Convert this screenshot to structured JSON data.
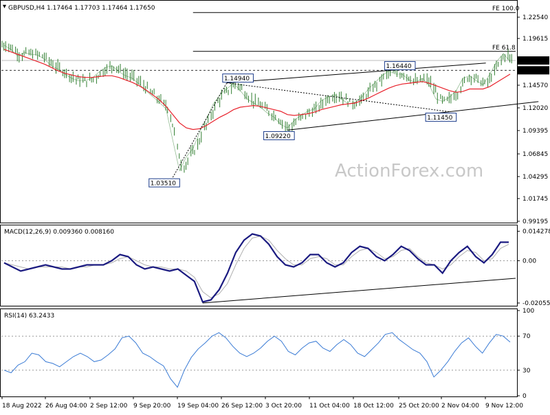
{
  "header": {
    "symbol": "GBPUSD,H4",
    "ohlc": "1.17464 1.17703 1.17464 1.17650"
  },
  "watermark": "ActionForex.com",
  "colors": {
    "ema_red": "#e8202a",
    "macd_blue": "#1a1a80",
    "signal_gray": "#b0b0b0",
    "rsi_blue": "#3a7bd5",
    "candle": "#2e7d2e",
    "lines": "#000000",
    "dashed": "#333333"
  },
  "chart_data": [
    {
      "type": "line",
      "panel": "price",
      "series": [
        {
          "values": [
            1.195,
            1.19,
            1.182,
            1.186,
            1.184,
            1.183,
            1.178,
            1.17,
            1.166,
            1.16,
            1.155,
            1.152,
            1.152,
            1.155,
            1.162,
            1.168,
            1.17,
            1.163,
            1.158,
            1.155,
            1.148,
            1.14,
            1.133,
            1.126,
            1.118,
            1.08,
            1.043,
            1.06,
            1.07,
            1.09,
            1.106,
            1.124,
            1.135,
            1.142,
            1.149,
            1.14,
            1.13,
            1.125,
            1.12,
            1.113,
            1.108,
            1.099,
            1.095,
            1.104,
            1.11,
            1.115,
            1.118,
            1.128,
            1.132,
            1.135,
            1.13,
            1.124,
            1.126,
            1.132,
            1.142,
            1.15,
            1.158,
            1.164,
            1.16,
            1.16,
            1.153,
            1.15,
            1.155,
            1.147,
            1.13,
            1.127,
            1.132,
            1.14,
            1.155,
            1.158,
            1.152,
            1.147,
            1.16,
            1.175,
            1.185,
            1.175
          ]
        },
        {
          "name": "EMA",
          "values": [
            1.19,
            1.187,
            1.184,
            1.181,
            1.178,
            1.175,
            1.172,
            1.168,
            1.164,
            1.161,
            1.159,
            1.157,
            1.156,
            1.156,
            1.157,
            1.158,
            1.158,
            1.156,
            1.153,
            1.15,
            1.146,
            1.141,
            1.135,
            1.129,
            1.121,
            1.111,
            1.101,
            1.095,
            1.093,
            1.094,
            1.098,
            1.103,
            1.108,
            1.112,
            1.117,
            1.12,
            1.121,
            1.122,
            1.121,
            1.119,
            1.117,
            1.115,
            1.111,
            1.11,
            1.111,
            1.112,
            1.114,
            1.117,
            1.119,
            1.121,
            1.123,
            1.124,
            1.125,
            1.128,
            1.131,
            1.135,
            1.139,
            1.143,
            1.146,
            1.148,
            1.149,
            1.15,
            1.151,
            1.149,
            1.146,
            1.143,
            1.14,
            1.138,
            1.139,
            1.142,
            1.142,
            1.142,
            1.145,
            1.15,
            1.155,
            1.16
          ]
        }
      ],
      "price_ticks": [
        "1.22540",
        "1.19615",
        "1.14570",
        "1.12020",
        "1.09395",
        "1.06845",
        "1.04295",
        "1.01745",
        "0.99195"
      ],
      "price_tags": [
        "1.17650",
        "1.16460"
      ],
      "annotations": [
        {
          "label": "1.03510",
          "x": 25,
          "y": 1.0351
        },
        {
          "label": "1.14940",
          "x": 33,
          "y": 1.1494
        },
        {
          "label": "1.09220",
          "x": 42,
          "y": 1.0922
        },
        {
          "label": "1.16440",
          "x": 57,
          "y": 1.1644
        },
        {
          "label": "1.11450",
          "x": 66,
          "y": 1.1145
        },
        {
          "label": "FE 100.0",
          "y": 1.2345
        },
        {
          "label": "FE 61.8",
          "y": 1.1875
        }
      ]
    },
    {
      "type": "line",
      "panel": "macd",
      "title": "MACD(12,26,9) 0.009360 0.008160",
      "ticks": [
        "0.014278",
        "0.00",
        "-0.020556"
      ],
      "series": [
        {
          "name": "MACD",
          "values": [
            -0.001,
            -0.003,
            -0.005,
            -0.004,
            -0.003,
            -0.002,
            -0.003,
            -0.004,
            -0.004,
            -0.003,
            -0.002,
            -0.002,
            -0.002,
            0.0,
            0.003,
            0.002,
            -0.002,
            -0.004,
            -0.003,
            -0.004,
            -0.005,
            -0.004,
            -0.007,
            -0.01,
            -0.02,
            -0.019,
            -0.014,
            -0.006,
            0.004,
            0.01,
            0.013,
            0.012,
            0.008,
            0.002,
            -0.002,
            -0.003,
            -0.001,
            0.003,
            0.003,
            -0.001,
            -0.003,
            -0.001,
            0.004,
            0.007,
            0.006,
            0.002,
            0.0,
            0.003,
            0.007,
            0.005,
            0.001,
            -0.002,
            -0.002,
            -0.006,
            0.0,
            0.004,
            0.007,
            0.002,
            -0.001,
            0.003,
            0.009,
            0.009
          ]
        },
        {
          "name": "Signal",
          "values": [
            -0.001,
            -0.002,
            -0.003,
            -0.004,
            -0.003,
            -0.003,
            -0.003,
            -0.003,
            -0.004,
            -0.003,
            -0.003,
            -0.002,
            -0.002,
            -0.001,
            0.001,
            0.002,
            0.0,
            -0.002,
            -0.003,
            -0.003,
            -0.004,
            -0.004,
            -0.005,
            -0.008,
            -0.015,
            -0.018,
            -0.016,
            -0.011,
            -0.002,
            0.006,
            0.011,
            0.012,
            0.01,
            0.005,
            0.001,
            -0.002,
            -0.002,
            0.001,
            0.002,
            0.001,
            -0.002,
            -0.002,
            0.002,
            0.005,
            0.006,
            0.004,
            0.001,
            0.002,
            0.005,
            0.006,
            0.002,
            -0.001,
            -0.002,
            -0.004,
            -0.002,
            0.002,
            0.005,
            0.004,
            0.0,
            0.001,
            0.006,
            0.008
          ]
        }
      ]
    },
    {
      "type": "line",
      "panel": "rsi",
      "title": "RSI(14) 63.2433",
      "ylim": [
        0,
        100
      ],
      "ticks": [
        "100",
        "70",
        "30",
        "0"
      ],
      "series": [
        {
          "name": "RSI",
          "values": [
            30,
            27,
            36,
            40,
            50,
            48,
            40,
            38,
            34,
            40,
            46,
            50,
            46,
            40,
            42,
            48,
            55,
            68,
            70,
            62,
            50,
            46,
            40,
            35,
            20,
            10,
            30,
            45,
            55,
            62,
            70,
            74,
            68,
            58,
            50,
            46,
            50,
            56,
            64,
            70,
            64,
            52,
            48,
            56,
            62,
            64,
            56,
            52,
            60,
            66,
            60,
            50,
            46,
            54,
            62,
            72,
            74,
            66,
            60,
            54,
            50,
            40,
            22,
            30,
            40,
            52,
            62,
            68,
            58,
            50,
            62,
            72,
            70,
            63
          ]
        }
      ]
    }
  ],
  "x_axis_labels": [
    "18 Aug 2022",
    "26 Aug 04:00",
    "2 Sep 12:00",
    "9 Sep 20:00",
    "19 Sep 04:00",
    "26 Sep 12:00",
    "3 Oct 20:00",
    "11 Oct 04:00",
    "18 Oct 12:00",
    "25 Oct 20:00",
    "2 Nov 04:00",
    "9 Nov 12:00"
  ]
}
